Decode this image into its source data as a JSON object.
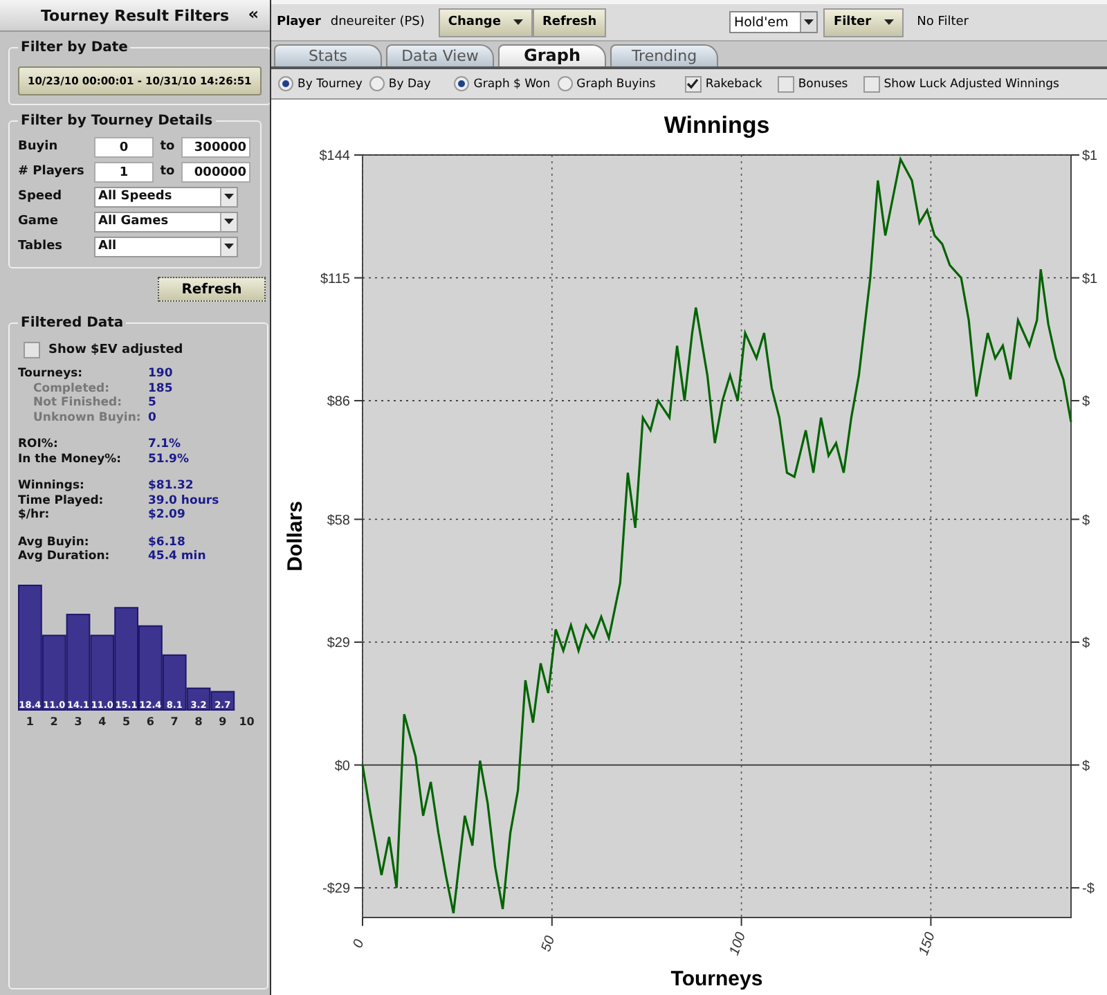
{
  "sidebar": {
    "title": "Tourney Result Filters",
    "collapse_icon": "«",
    "date_filter": {
      "title": "Filter by Date",
      "range_button": "10/23/10 00:00:01 - 10/31/10 14:26:51"
    },
    "details_filter": {
      "title": "Filter by Tourney Details",
      "ranges": [
        {
          "label": "Buyin",
          "from": "0",
          "to_label": "to",
          "to": "300000"
        },
        {
          "label": "# Players",
          "from": "1",
          "to_label": "to",
          "to": "000000"
        }
      ],
      "selects": [
        {
          "label": "Speed",
          "value": "All Speeds"
        },
        {
          "label": "Game",
          "value": "All Games"
        },
        {
          "label": "Tables",
          "value": "All"
        }
      ]
    },
    "refresh_button": "Refresh",
    "filtered_data": {
      "title": "Filtered Data",
      "ev_checkbox": {
        "label": "Show $EV adjusted",
        "checked": false
      },
      "stat_groups": [
        [
          {
            "label": "Tourneys:",
            "value": "190",
            "kind": "main"
          },
          {
            "label": "Completed:",
            "value": "185",
            "kind": "sub"
          },
          {
            "label": "Not Finished:",
            "value": "5",
            "kind": "sub"
          },
          {
            "label": "Unknown Buyin:",
            "value": "0",
            "kind": "sub"
          }
        ],
        [
          {
            "label": "ROI%:",
            "value": "7.1%",
            "kind": "main"
          },
          {
            "label": "In the Money%:",
            "value": "51.9%",
            "kind": "main"
          }
        ],
        [
          {
            "label": "Winnings:",
            "value": "$81.32",
            "kind": "main"
          },
          {
            "label": "Time Played:",
            "value": "39.0 hours",
            "kind": "main"
          },
          {
            "label": "$/hr:",
            "value": "$2.09",
            "kind": "main"
          }
        ],
        [
          {
            "label": "Avg Buyin:",
            "value": "$6.18",
            "kind": "main"
          },
          {
            "label": "Avg Duration:",
            "value": "45.4 min",
            "kind": "main"
          }
        ]
      ],
      "chart_data": {
        "type": "bar",
        "categories": [
          "1",
          "2",
          "3",
          "4",
          "5",
          "6",
          "7",
          "8",
          "9",
          "10"
        ],
        "series": [
          {
            "color": "#3d3490",
            "values": [
              18.4,
              11.0,
              14.1,
              11.0,
              15.1,
              12.4,
              8.1,
              3.2,
              2.7,
              null
            ],
            "value_labels": [
              "18.4",
              "11.0",
              "14.1",
              "11.0",
              "15.1",
              "12.4",
              "8.1",
              "3.2",
              "2.7",
              null
            ]
          }
        ]
      }
    }
  },
  "toolbar": {
    "player_label": "Player",
    "player_name": "dneureiter (PS)",
    "buttons": [
      {
        "label": "Change",
        "dropdown": true
      },
      {
        "label": "Refresh",
        "dropdown": false
      }
    ],
    "game_select": "Hold'em",
    "filter_button": {
      "label": "Filter",
      "dropdown": true
    },
    "filter_status": "No Filter"
  },
  "tabs": [
    {
      "label": "Stats",
      "selected": false
    },
    {
      "label": "Data View",
      "selected": false
    },
    {
      "label": "Graph",
      "selected": true
    },
    {
      "label": "Trending",
      "selected": false
    }
  ],
  "options": {
    "radio_groups": [
      [
        {
          "label": "By Tourney",
          "selected": true
        },
        {
          "label": "By Day",
          "selected": false
        }
      ],
      [
        {
          "label": "Graph $ Won",
          "selected": true
        },
        {
          "label": "Graph Buyins",
          "selected": false
        }
      ]
    ],
    "checkboxes": [
      {
        "label": "Rakeback",
        "checked": true
      },
      {
        "label": "Bonuses",
        "checked": false
      },
      {
        "label": "Show Luck Adjusted Winnings",
        "checked": false
      }
    ]
  },
  "graph": {
    "right_axis_labels": [
      "$1",
      "$1",
      "$",
      "$",
      "$",
      "$",
      "-$"
    ],
    "chart_data": {
      "type": "line",
      "title": "Winnings",
      "xlabel": "Tourneys",
      "ylabel": "Dollars",
      "x": [
        0,
        2,
        5,
        7,
        9,
        11,
        14,
        16,
        18,
        20,
        22,
        24,
        27,
        29,
        31,
        33,
        35,
        37,
        39,
        41,
        43,
        45,
        47,
        49,
        51,
        53,
        55,
        57,
        59,
        61,
        63,
        65,
        68,
        70,
        72,
        74,
        76,
        78,
        81,
        83,
        85,
        87,
        88,
        91,
        93,
        95,
        97,
        99,
        101,
        104,
        106,
        108,
        110,
        112,
        114,
        117,
        119,
        121,
        123,
        125,
        127,
        129,
        131,
        134,
        136,
        138,
        140,
        142,
        145,
        147,
        149,
        151,
        153,
        155,
        158,
        160,
        162,
        165,
        167,
        169,
        171,
        173,
        176,
        178,
        179,
        181,
        183,
        185,
        187
      ],
      "series": [
        {
          "color": "#006400",
          "values": [
            0,
            -11,
            -26,
            -17,
            -29,
            12,
            2,
            -12,
            -4,
            -16,
            -26,
            -35,
            -12,
            -19,
            1,
            -9,
            -24,
            -34,
            -16,
            -6,
            20,
            10,
            24,
            17,
            32,
            27,
            33,
            27,
            33,
            30,
            35,
            30,
            43,
            69,
            56,
            82,
            79,
            86,
            82,
            99,
            86,
            102,
            108,
            92,
            76,
            86,
            92,
            86,
            102,
            96,
            102,
            89,
            82,
            69,
            68,
            79,
            69,
            82,
            73,
            76,
            69,
            82,
            92,
            115,
            138,
            125,
            134,
            143,
            138,
            128,
            131,
            125,
            123,
            118,
            115,
            105,
            87,
            102,
            96,
            99,
            91,
            105,
            99,
            105,
            117,
            104,
            96,
            91,
            81
          ]
        }
      ],
      "grid": true,
      "xlim": [
        0,
        187
      ],
      "ylim": [
        -36,
        144
      ],
      "xticks": [
        0,
        50,
        100,
        150
      ],
      "yticks": [
        {
          "value": -29,
          "label": "-$29"
        },
        {
          "value": 0,
          "label": "$0"
        },
        {
          "value": 29,
          "label": "$29"
        },
        {
          "value": 58,
          "label": "$58"
        },
        {
          "value": 86,
          "label": "$86"
        },
        {
          "value": 115,
          "label": "$115"
        },
        {
          "value": 144,
          "label": "$144"
        }
      ]
    }
  }
}
